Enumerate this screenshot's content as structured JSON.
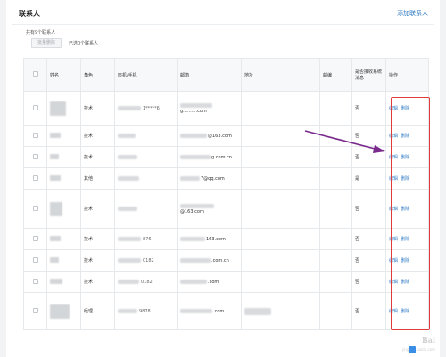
{
  "header": {
    "title": "联系人",
    "add_link": "添加联系人"
  },
  "summary": {
    "count_text": "共有9个联系人",
    "batch_delete_label": "批量删除",
    "selected_text": "已选0个联系人"
  },
  "table": {
    "columns": [
      "",
      "姓名",
      "角色",
      "座机/手机",
      "邮箱",
      "地址",
      "邮编",
      "是否接收系统消息",
      "操作"
    ],
    "rows": [
      {
        "name": "",
        "role": "技术",
        "phone": "1*****6",
        "email": "g..........com",
        "address": "",
        "zip": "",
        "receive": "否",
        "edit": "编辑",
        "delete": "删除"
      },
      {
        "name": "",
        "role": "技术",
        "phone": "",
        "email": "@163.com",
        "address": "",
        "zip": "",
        "receive": "否",
        "edit": "编辑",
        "delete": "删除"
      },
      {
        "name": "",
        "role": "技术",
        "phone": "",
        "email": "g.com.cn",
        "address": "",
        "zip": "",
        "receive": "否",
        "edit": "编辑",
        "delete": "删除"
      },
      {
        "name": "",
        "role": "其他",
        "phone": "",
        "email": "7@qq.com",
        "address": "",
        "zip": "",
        "receive": "是",
        "edit": "编辑",
        "delete": "删除"
      },
      {
        "name": "",
        "role": "技术",
        "phone": "",
        "email": "@163.com",
        "address": "",
        "zip": "",
        "receive": "否",
        "edit": "编辑",
        "delete": "删除"
      },
      {
        "name": "",
        "role": "技术",
        "phone": "876",
        "email": "163.com",
        "address": "",
        "zip": "",
        "receive": "否",
        "edit": "编辑",
        "delete": "删除"
      },
      {
        "name": "",
        "role": "技术",
        "phone": "0182",
        "email": ".com.cn",
        "address": "",
        "zip": "",
        "receive": "否",
        "edit": "编辑",
        "delete": "删除"
      },
      {
        "name": "",
        "role": "技术",
        "phone": "0182",
        "email": ".com",
        "address": "",
        "zip": "",
        "receive": "否",
        "edit": "编辑",
        "delete": "删除"
      },
      {
        "name": "",
        "role": "经理",
        "phone": "9878",
        "email": ".com",
        "address": "",
        "zip": "",
        "receive": "否",
        "edit": "编辑",
        "delete": "删除"
      }
    ]
  },
  "watermark": {
    "brand": "Bai",
    "url": "jingyan.baidu.com"
  },
  "colors": {
    "link": "#2f7bc4",
    "highlight_box": "#e03b3b",
    "arrow": "#7a2a8c"
  }
}
